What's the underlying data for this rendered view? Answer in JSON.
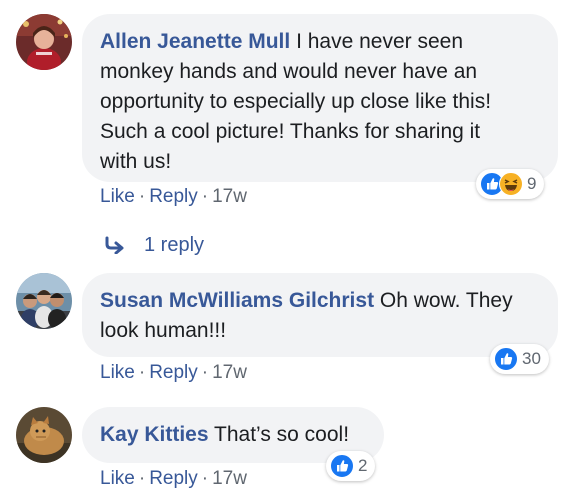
{
  "comments": [
    {
      "author": "Allen Jeanette Mull",
      "text_lines": [
        "I have never seen",
        "monkey hands and would never have an",
        "opportunity to especially up close like this!",
        "Such a cool picture! Thanks for sharing it",
        "with us!"
      ],
      "like_label": "Like",
      "reply_label": "Reply",
      "time": "17w",
      "reaction_count": "9",
      "reactions": [
        "like-icon",
        "haha-icon"
      ]
    },
    {
      "author": "Susan McWilliams Gilchrist",
      "text_lines": [
        "Oh wow. They",
        "look human!!!"
      ],
      "like_label": "Like",
      "reply_label": "Reply",
      "time": "17w",
      "reaction_count": "30",
      "reactions": [
        "like-icon"
      ]
    },
    {
      "author": "Kay Kitties",
      "text_lines": [
        "That’s so cool!"
      ],
      "like_label": "Like",
      "reply_label": "Reply",
      "time": "17w",
      "reaction_count": "2",
      "reactions": [
        "like-icon"
      ]
    }
  ],
  "replies_link": {
    "label": "1 reply",
    "icon": "reply-arrow-icon"
  },
  "separator": "·",
  "colors": {
    "link": "#385898",
    "bubble": "#f2f3f5",
    "meta": "#606770",
    "like_blue": "#1877f2",
    "haha_yellow": "#f7b125"
  }
}
